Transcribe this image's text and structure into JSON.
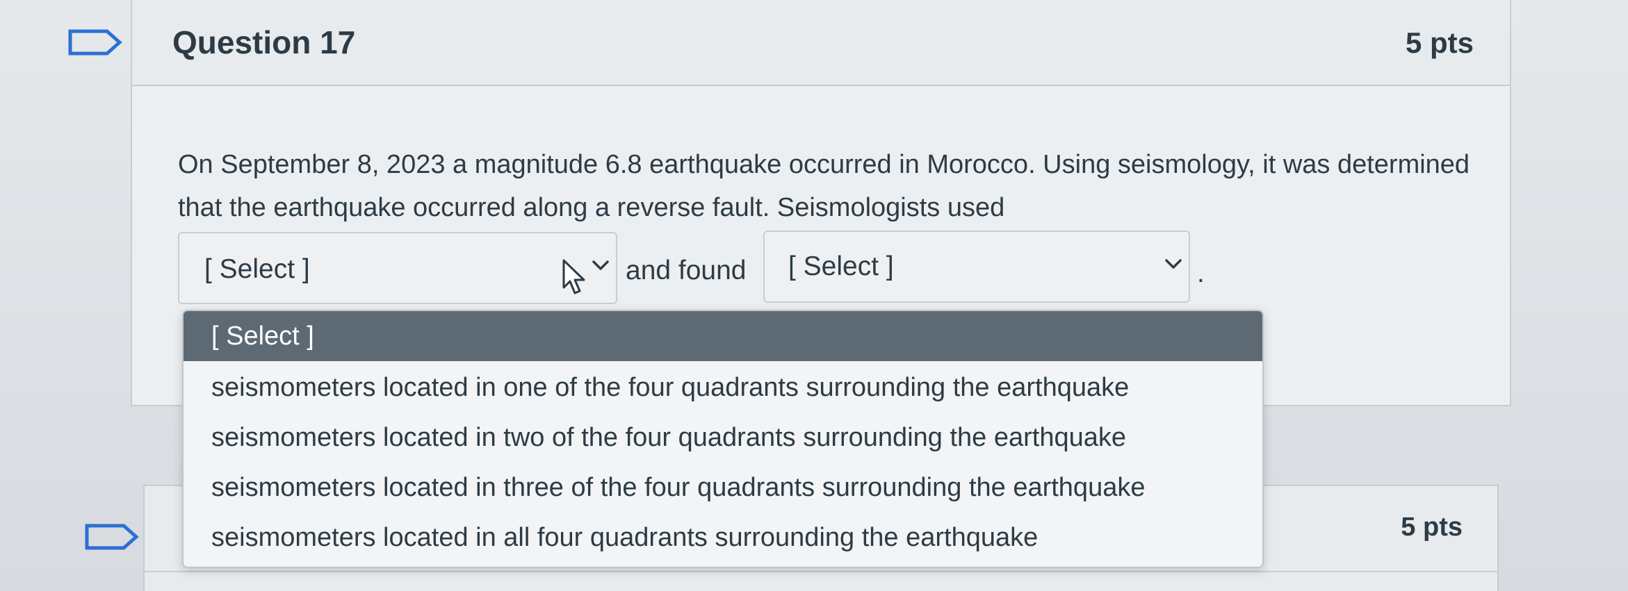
{
  "question": {
    "title": "Question 17",
    "points": "5 pts",
    "text": "On September 8, 2023 a magnitude 6.8 earthquake occurred in Morocco.  Using seismology, it was determined that the earthquake occurred along a reverse fault.  Seismologists used"
  },
  "select1": {
    "value": "[ Select ]"
  },
  "connector_text": "and found",
  "select2": {
    "value": "[ Select ]"
  },
  "sentence_end": ".",
  "dropdown": {
    "options": [
      "[ Select ]",
      "seismometers located in one of the four quadrants surrounding the earthquake",
      "seismometers located in two of the four quadrants surrounding the earthquake",
      "seismometers located in three of the four quadrants surrounding the earthquake",
      "seismometers located in all four quadrants surrounding the earthquake"
    ],
    "highlighted_index": 0
  },
  "next_question": {
    "points": "5 pts"
  },
  "colors": {
    "text": "#2d3b45",
    "flag": "#2d6fd3",
    "highlight": "#5d6a74"
  },
  "icons": [
    "bookmark-flag-icon",
    "chevron-down-icon",
    "mouse-pointer-icon"
  ]
}
